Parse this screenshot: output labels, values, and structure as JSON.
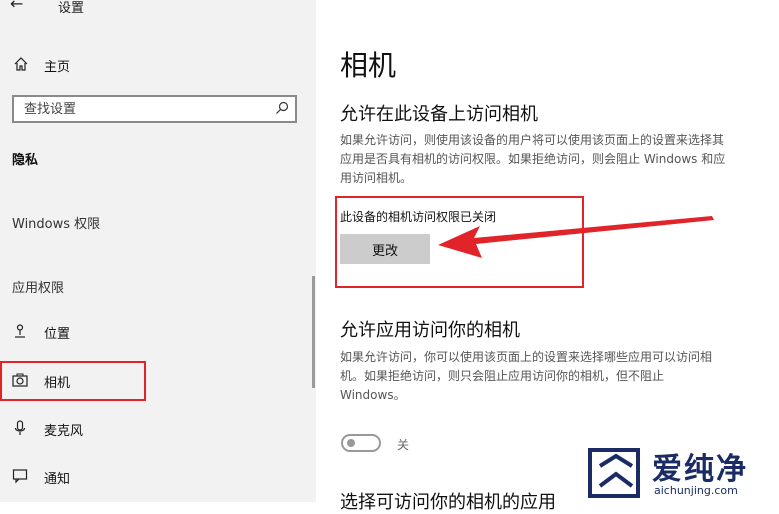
{
  "window": {
    "title": "设置"
  },
  "sidebar": {
    "home_label": "主页",
    "search_placeholder": "查找设置",
    "sections": {
      "privacy": "隐私",
      "windows_permissions": "Windows 权限",
      "app_permissions": "应用权限"
    },
    "items": [
      {
        "label": "位置",
        "icon": "location-icon"
      },
      {
        "label": "相机",
        "icon": "camera-icon",
        "selected": true
      },
      {
        "label": "麦克风",
        "icon": "microphone-icon"
      },
      {
        "label": "通知",
        "icon": "notification-icon"
      }
    ]
  },
  "main": {
    "title": "相机",
    "device_section": {
      "heading": "允许在此设备上访问相机",
      "description": "如果允许访问，则使用该设备的用户将可以使用该页面上的设置来选择其\n应用是否具有相机的访问权限。如果拒绝访问，则会阻止 Windows 和应\n用访问相机。",
      "status": "此设备的相机访问权限已关闭",
      "change_label": "更改"
    },
    "apps_section": {
      "heading": "允许应用访问你的相机",
      "description": "如果允许访问，你可以使用该页面上的设置来选择哪些应用可以访问相\n机。如果拒绝访问，则只会阻止应用访问你的相机，但不阻止\nWindows。",
      "toggle_state": "关"
    },
    "choose_section": {
      "heading": "选择可访问你的相机的应用"
    }
  },
  "watermark": {
    "brand": "爱纯净",
    "domain": "aichunjing.com"
  },
  "colors": {
    "highlight": "#e0242a",
    "sidebar_bg": "#f2f2f2",
    "watermark": "#1a2b66"
  }
}
